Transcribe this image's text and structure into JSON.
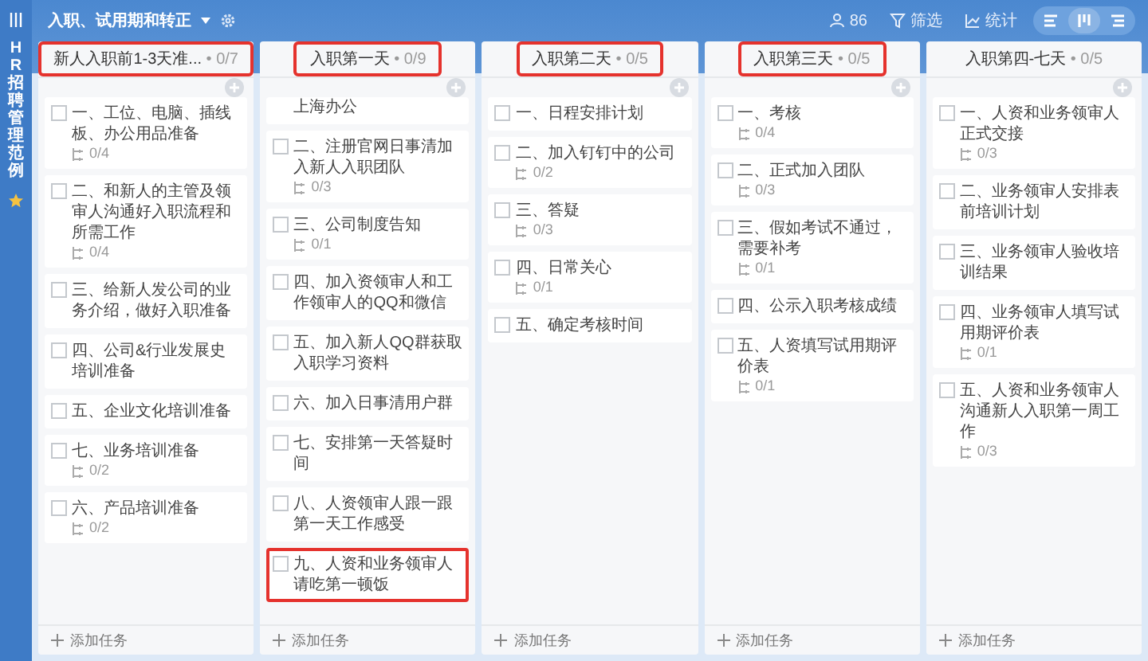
{
  "sidebar": {
    "label": "HR招聘管理范例",
    "starred": true
  },
  "toolbar": {
    "title": "入职、试用期和转正",
    "members": "86",
    "actions": [
      {
        "kind": "filter",
        "label": "筛选"
      },
      {
        "kind": "stats",
        "label": "统计"
      }
    ],
    "views": [
      {
        "kind": "list",
        "selected": false
      },
      {
        "kind": "board",
        "selected": true
      },
      {
        "kind": "menu",
        "selected": false
      }
    ]
  },
  "columns": [
    {
      "title": "新人入职前1-3天准...",
      "count": "• 0/7",
      "highlighted": true,
      "add_label": "添加任务",
      "cards": [
        {
          "title": "一、工位、电脑、插线板、办公用品准备",
          "subtasks": "0/4",
          "checked": false,
          "highlighted": false
        },
        {
          "title": "二、和新人的主管及领审人沟通好入职流程和所需工作",
          "subtasks": "0/4",
          "checked": false,
          "highlighted": false
        },
        {
          "title": "三、给新人发公司的业务介绍，做好入职准备",
          "checked": false,
          "highlighted": false
        },
        {
          "title": "四、公司&行业发展史培训准备",
          "checked": false,
          "highlighted": false
        },
        {
          "title": "五、企业文化培训准备",
          "checked": false,
          "highlighted": false
        },
        {
          "title": "七、业务培训准备",
          "subtasks": "0/2",
          "checked": false,
          "highlighted": false
        },
        {
          "title": "六、产品培训准备",
          "subtasks": "0/2",
          "checked": false,
          "highlighted": false
        }
      ]
    },
    {
      "title": "入职第一天",
      "count": "• 0/9",
      "highlighted": true,
      "add_label": "添加任务",
      "cards": [
        {
          "title": "上海办公",
          "partial": true,
          "highlighted": false
        },
        {
          "title": "二、注册官网日事清加入新人入职团队",
          "subtasks": "0/3",
          "checked": false,
          "highlighted": false
        },
        {
          "title": "三、公司制度告知",
          "subtasks": "0/1",
          "checked": false,
          "highlighted": false
        },
        {
          "title": "四、加入资领审人和工作领审人的QQ和微信",
          "checked": false,
          "highlighted": false
        },
        {
          "title": "五、加入新人QQ群获取入职学习资料",
          "checked": false,
          "highlighted": false
        },
        {
          "title": "六、加入日事清用户群",
          "checked": false,
          "highlighted": false
        },
        {
          "title": "七、安排第一天答疑时间",
          "checked": false,
          "highlighted": false
        },
        {
          "title": "八、人资领审人跟一跟第一天工作感受",
          "checked": false,
          "highlighted": false
        },
        {
          "title": "九、人资和业务领审人请吃第一顿饭",
          "checked": false,
          "highlighted": true
        }
      ]
    },
    {
      "title": "入职第二天",
      "count": "• 0/5",
      "highlighted": true,
      "add_label": "添加任务",
      "cards": [
        {
          "title": "一、日程安排计划",
          "checked": false,
          "highlighted": false
        },
        {
          "title": "二、加入钉钉中的公司",
          "subtasks": "0/2",
          "checked": false,
          "highlighted": false
        },
        {
          "title": "三、答疑",
          "subtasks": "0/3",
          "checked": false,
          "highlighted": false
        },
        {
          "title": "四、日常关心",
          "subtasks": "0/1",
          "checked": false,
          "highlighted": false
        },
        {
          "title": "五、确定考核时间",
          "checked": false,
          "highlighted": false
        }
      ]
    },
    {
      "title": "入职第三天",
      "count": "• 0/5",
      "highlighted": true,
      "add_label": "添加任务",
      "cards": [
        {
          "title": "一、考核",
          "subtasks": "0/4",
          "checked": false,
          "highlighted": false
        },
        {
          "title": "二、正式加入团队",
          "subtasks": "0/3",
          "checked": false,
          "highlighted": false
        },
        {
          "title": "三、假如考试不通过，需要补考",
          "subtasks": "0/1",
          "checked": false,
          "highlighted": false
        },
        {
          "title": "四、公示入职考核成绩",
          "checked": false,
          "highlighted": false
        },
        {
          "title": "五、人资填写试用期评价表",
          "subtasks": "0/1",
          "checked": false,
          "highlighted": false
        }
      ]
    },
    {
      "title": "入职第四-七天",
      "count": "• 0/5",
      "highlighted": false,
      "add_label": "添加任务",
      "cards": [
        {
          "title": "一、人资和业务领审人正式交接",
          "subtasks": "0/3",
          "checked": false,
          "highlighted": false
        },
        {
          "title": "二、业务领审人安排表前培训计划",
          "checked": false,
          "highlighted": false
        },
        {
          "title": "三、业务领审人验收培训结果",
          "checked": false,
          "highlighted": false
        },
        {
          "title": "四、业务领审人填写试用期评价表",
          "subtasks": "0/1",
          "checked": false,
          "highlighted": false
        },
        {
          "title": "五、人资和业务领审人沟通新人入职第一周工作",
          "subtasks": "0/3",
          "checked": false,
          "highlighted": false
        }
      ]
    }
  ]
}
